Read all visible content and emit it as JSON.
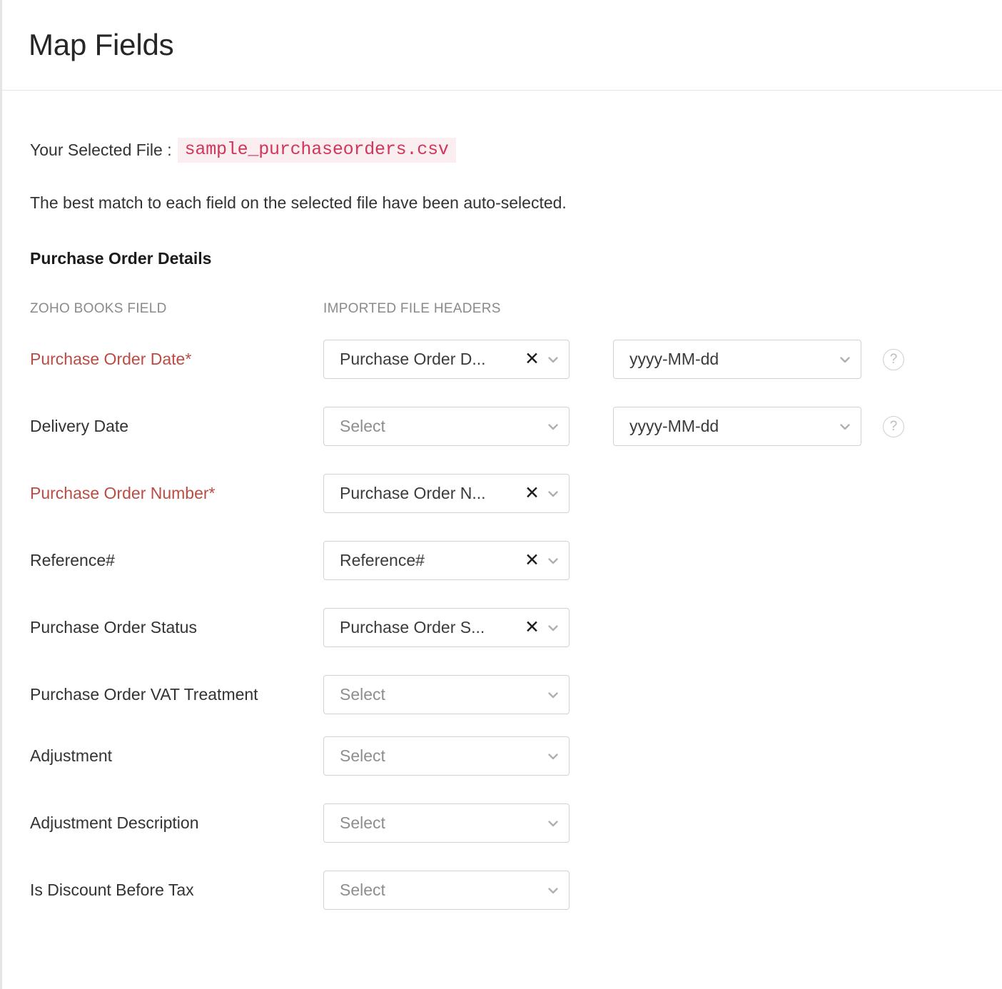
{
  "header": {
    "title": "Map Fields"
  },
  "file_info": {
    "label": "Your Selected File :",
    "filename": "sample_purchaseorders.csv",
    "filename_color": "#d0365a",
    "filename_bg": "#fbeef1"
  },
  "intro": {
    "text": "The best match to each field on the selected file have been auto-selected."
  },
  "section": {
    "title": "Purchase Order Details"
  },
  "columns": {
    "field": "ZOHO BOOKS FIELD",
    "imported": "IMPORTED FILE HEADERS"
  },
  "icons": {
    "clear": "✕",
    "help": "?",
    "chevron": "chevron-down-icon"
  },
  "colors": {
    "required": "#bb4b43",
    "label": "#333333",
    "placeholder": "#8e8e8e",
    "border": "#d2d2d2"
  },
  "placeholders": {
    "select": "Select"
  },
  "rows": [
    {
      "label": "Purchase Order Date*",
      "required": true,
      "mapped": "Purchase Order D...",
      "has_clear": true,
      "has_format": true,
      "format": "yyyy-MM-dd",
      "has_help": true
    },
    {
      "label": "Delivery Date",
      "required": false,
      "mapped": "Select",
      "has_clear": false,
      "has_format": true,
      "format": "yyyy-MM-dd",
      "has_help": true
    },
    {
      "label": "Purchase Order Number*",
      "required": true,
      "mapped": "Purchase Order N...",
      "has_clear": true,
      "has_format": false,
      "format": "",
      "has_help": false
    },
    {
      "label": "Reference#",
      "required": false,
      "mapped": "Reference#",
      "has_clear": true,
      "has_format": false,
      "format": "",
      "has_help": false
    },
    {
      "label": "Purchase Order Status",
      "required": false,
      "mapped": "Purchase Order S...",
      "has_clear": true,
      "has_format": false,
      "format": "",
      "has_help": false
    },
    {
      "label": "Purchase Order VAT Treatment",
      "required": false,
      "mapped": "Select",
      "has_clear": false,
      "has_format": false,
      "format": "",
      "has_help": false
    },
    {
      "label": "Adjustment",
      "required": false,
      "mapped": "Select",
      "has_clear": false,
      "has_format": false,
      "format": "",
      "has_help": false
    },
    {
      "label": "Adjustment Description",
      "required": false,
      "mapped": "Select",
      "has_clear": false,
      "has_format": false,
      "format": "",
      "has_help": false
    },
    {
      "label": "Is Discount Before Tax",
      "required": false,
      "mapped": "Select",
      "has_clear": false,
      "has_format": false,
      "format": "",
      "has_help": false
    }
  ]
}
